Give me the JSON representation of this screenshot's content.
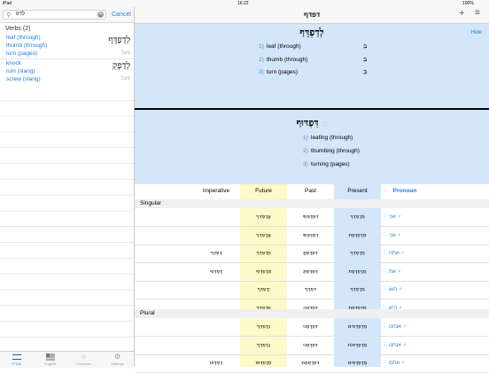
{
  "status": {
    "device": "iPad",
    "time": "16:22",
    "battery": "100%"
  },
  "search": {
    "query": "לדפ",
    "cancel": "Cancel"
  },
  "results": {
    "header": "Verbs (2)",
    "items": [
      {
        "en": [
          "leaf (through)",
          "thumb (through)",
          "turn (pages)"
        ],
        "heb": "לְדַפְדֵּף",
        "binyan": "פִּעֵל"
      },
      {
        "en": [
          "knock",
          "ruin (slang)",
          "screw (slang)"
        ],
        "heb": "לְדַפְקֵ",
        "binyan": "פִּעֵל"
      }
    ]
  },
  "tabs": [
    {
      "label": "עברית",
      "icon": "flag-il-icon"
    },
    {
      "label": "English",
      "icon": "flag-us-icon"
    },
    {
      "label": "Favorites",
      "icon": "star-icon"
    },
    {
      "label": "Settings",
      "icon": "gear-icon"
    }
  ],
  "nav": {
    "title": "דפדף"
  },
  "panel1": {
    "title": "לְדַפְדֵּף",
    "hide": "Hide",
    "senses": [
      {
        "n": "1)",
        "t": "leaf (through)",
        "h": "בְּ"
      },
      {
        "n": "2)",
        "t": "thumb (through)",
        "h": "בְּ"
      },
      {
        "n": "3)",
        "t": "turn (pages)",
        "h": "בְּ"
      }
    ]
  },
  "panel2": {
    "title": "דִּפְדּוּף",
    "senses": [
      {
        "n": "1)",
        "t": "leafing (through)"
      },
      {
        "n": "2)",
        "t": "thumbing (through)"
      },
      {
        "n": "3)",
        "t": "turning (pages)"
      }
    ]
  },
  "table": {
    "headers": {
      "imperative": "Imperative",
      "future": "Future",
      "past": "Past",
      "present": "Present",
      "pronoun": "Pronoun"
    },
    "singular_label": "Singular",
    "plural_label": "Plural",
    "singular": [
      {
        "pron": "אני ♂",
        "present": "מְדַפְדֵּף",
        "past": "דִּפְדַּפְתִּי",
        "future": "אֲדַפְדֵּף",
        "imp": ""
      },
      {
        "pron": "אני ♀",
        "present": "מְדַפְדֶּפֶת",
        "past": "דִּפְדַּפְתִּי",
        "future": "אֲדַפְדֵּף",
        "imp": ""
      },
      {
        "pron": "אתה ♂",
        "present": "מְדַפְדֵּף",
        "past": "דִּפְדַּפְתָּ",
        "future": "תְּדַפְדֵּף",
        "imp": "דַּפְדֵּף"
      },
      {
        "pron": "את ♀",
        "present": "מְדַפְדֶּפֶת",
        "past": "דִּפְדַּפְתְּ",
        "future": "תְּדַפְדְּפִי",
        "imp": "דַּפְדְּפִי"
      },
      {
        "pron": "הוא ♂",
        "present": "מְדַפְדֵּף",
        "past": "דִּפְדֵּף",
        "future": "יְדַפְדֵּף",
        "imp": ""
      },
      {
        "pron": "היא ♀",
        "present": "מְדַפְדֶּפֶת",
        "past": "דִּפְדְּפָה",
        "future": "תְּדַפְדֵּף",
        "imp": ""
      }
    ],
    "plural": [
      {
        "pron": "אנחנו ♂",
        "present": "מְדַפְדְּפִים",
        "past": "דִּפְדַּפְנוּ",
        "future": "נְדַפְדֵּף",
        "imp": ""
      },
      {
        "pron": "אנחנו ♀",
        "present": "מְדַפְדְּפוֹת",
        "past": "דִּפְדַּפְנוּ",
        "future": "נְדַפְדֵּף",
        "imp": ""
      },
      {
        "pron": "אתם ♂",
        "present": "מְדַפְדְּפִים",
        "past": "דִּפְדַּפְתֶּם",
        "future": "תְּדַפְדְּפוּ",
        "imp": "דַּפְדְּפוּ"
      }
    ]
  },
  "colors": {
    "accent": "#1a7fd9",
    "panel": "#d4e6f9",
    "future_col": "#fdf9c9",
    "present_col": "#d4e6f9"
  }
}
